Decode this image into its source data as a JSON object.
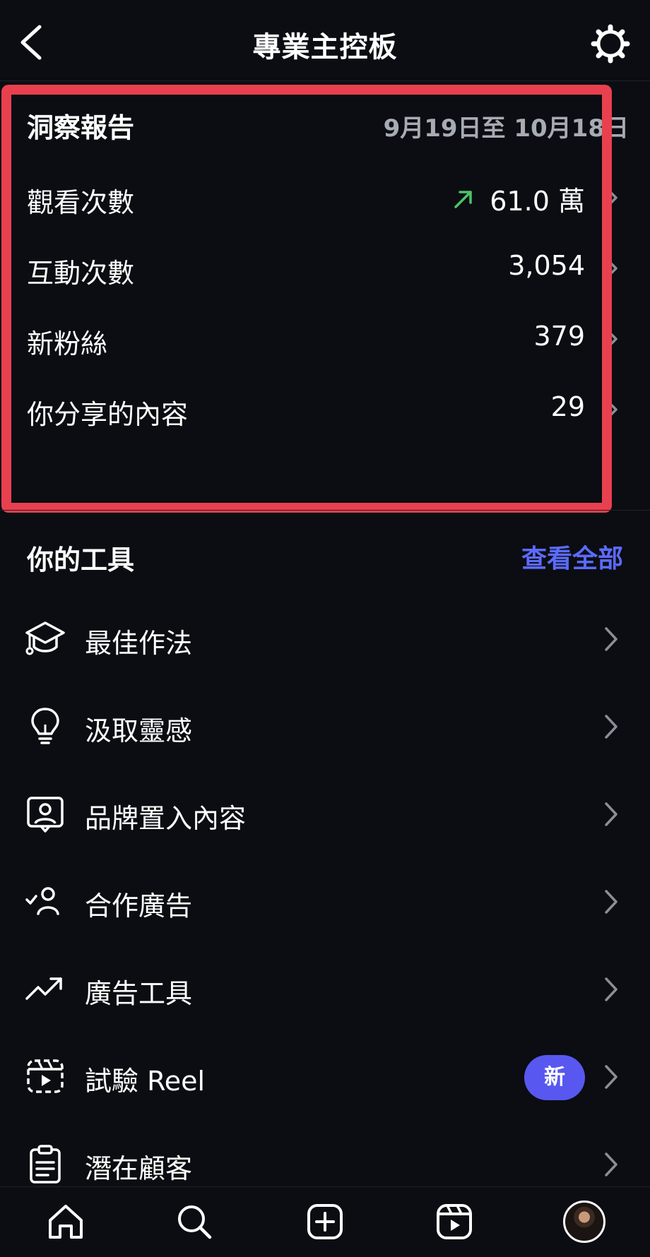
{
  "header": {
    "title": "專業主控板"
  },
  "insights": {
    "title": "洞察報告",
    "date_range": "9月19日至 10月18日",
    "metrics": [
      {
        "label": "觀看次數",
        "value": "61.0 萬",
        "trend": "up"
      },
      {
        "label": "互動次數",
        "value": "3,054"
      },
      {
        "label": "新粉絲",
        "value": "379"
      },
      {
        "label": "你分享的內容",
        "value": "29"
      }
    ]
  },
  "tools": {
    "title": "你的工具",
    "see_all": "查看全部",
    "items": [
      {
        "label": "最佳作法",
        "icon": "graduation-cap-icon"
      },
      {
        "label": "汲取靈感",
        "icon": "lightbulb-icon"
      },
      {
        "label": "品牌置入內容",
        "icon": "branded-content-icon"
      },
      {
        "label": "合作廣告",
        "icon": "partnership-user-icon"
      },
      {
        "label": "廣告工具",
        "icon": "trending-up-icon"
      },
      {
        "label": "試驗 Reel",
        "icon": "reel-trial-icon",
        "badge": "新"
      },
      {
        "label": "潛在顧客",
        "icon": "clipboard-icon"
      }
    ]
  },
  "colors": {
    "background": "#0b0d12",
    "highlight": "#e9404f",
    "accent": "#5b6bff",
    "badge": "#5858f0",
    "trend_up": "#4cc36a"
  },
  "bottom_nav": [
    "home-icon",
    "search-icon",
    "create-icon",
    "reels-icon",
    "profile-avatar"
  ]
}
